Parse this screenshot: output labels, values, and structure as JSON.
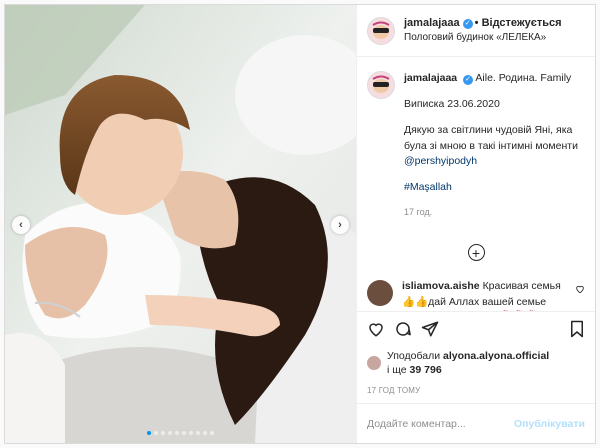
{
  "post": {
    "author": {
      "username": "jamalajaaa",
      "verified_icon": "verified-badge-icon",
      "follow_status": "• Відстежується",
      "location": "Пологовий будинок «ЛЕЛЕКА»"
    },
    "caption": {
      "username": "jamalajaaa",
      "headline": "Aile. Родина. Family",
      "date_line": "Виписка 23.06.2020",
      "thanks": "Дякую за світлини чудовій Яні, яка була зі мною в такі інтимні моменти",
      "mention": "@pershyipodyh",
      "hashtag": "#Maşallah",
      "time_ago": "17 год."
    },
    "comment": {
      "username": "isliamova.aishe",
      "text": "Красивая семья 👍👍дай Аллах вашей семье счастье и здоровье 🌹🌹🌹"
    },
    "likes": {
      "prefix": "Уподобали",
      "user": "alyona.alyona.official",
      "joiner": "і ще",
      "count": "39 796"
    },
    "timestamp": "17 ГОД ТОМУ",
    "add_comment": {
      "placeholder": "Додайте коментар...",
      "publish_label": "Опублікувати"
    },
    "carousel": {
      "slide_count": 10,
      "active_index": 0
    },
    "colors": {
      "accent": "#0095f6",
      "link": "#00376b",
      "muted": "#8e8e8e"
    }
  }
}
